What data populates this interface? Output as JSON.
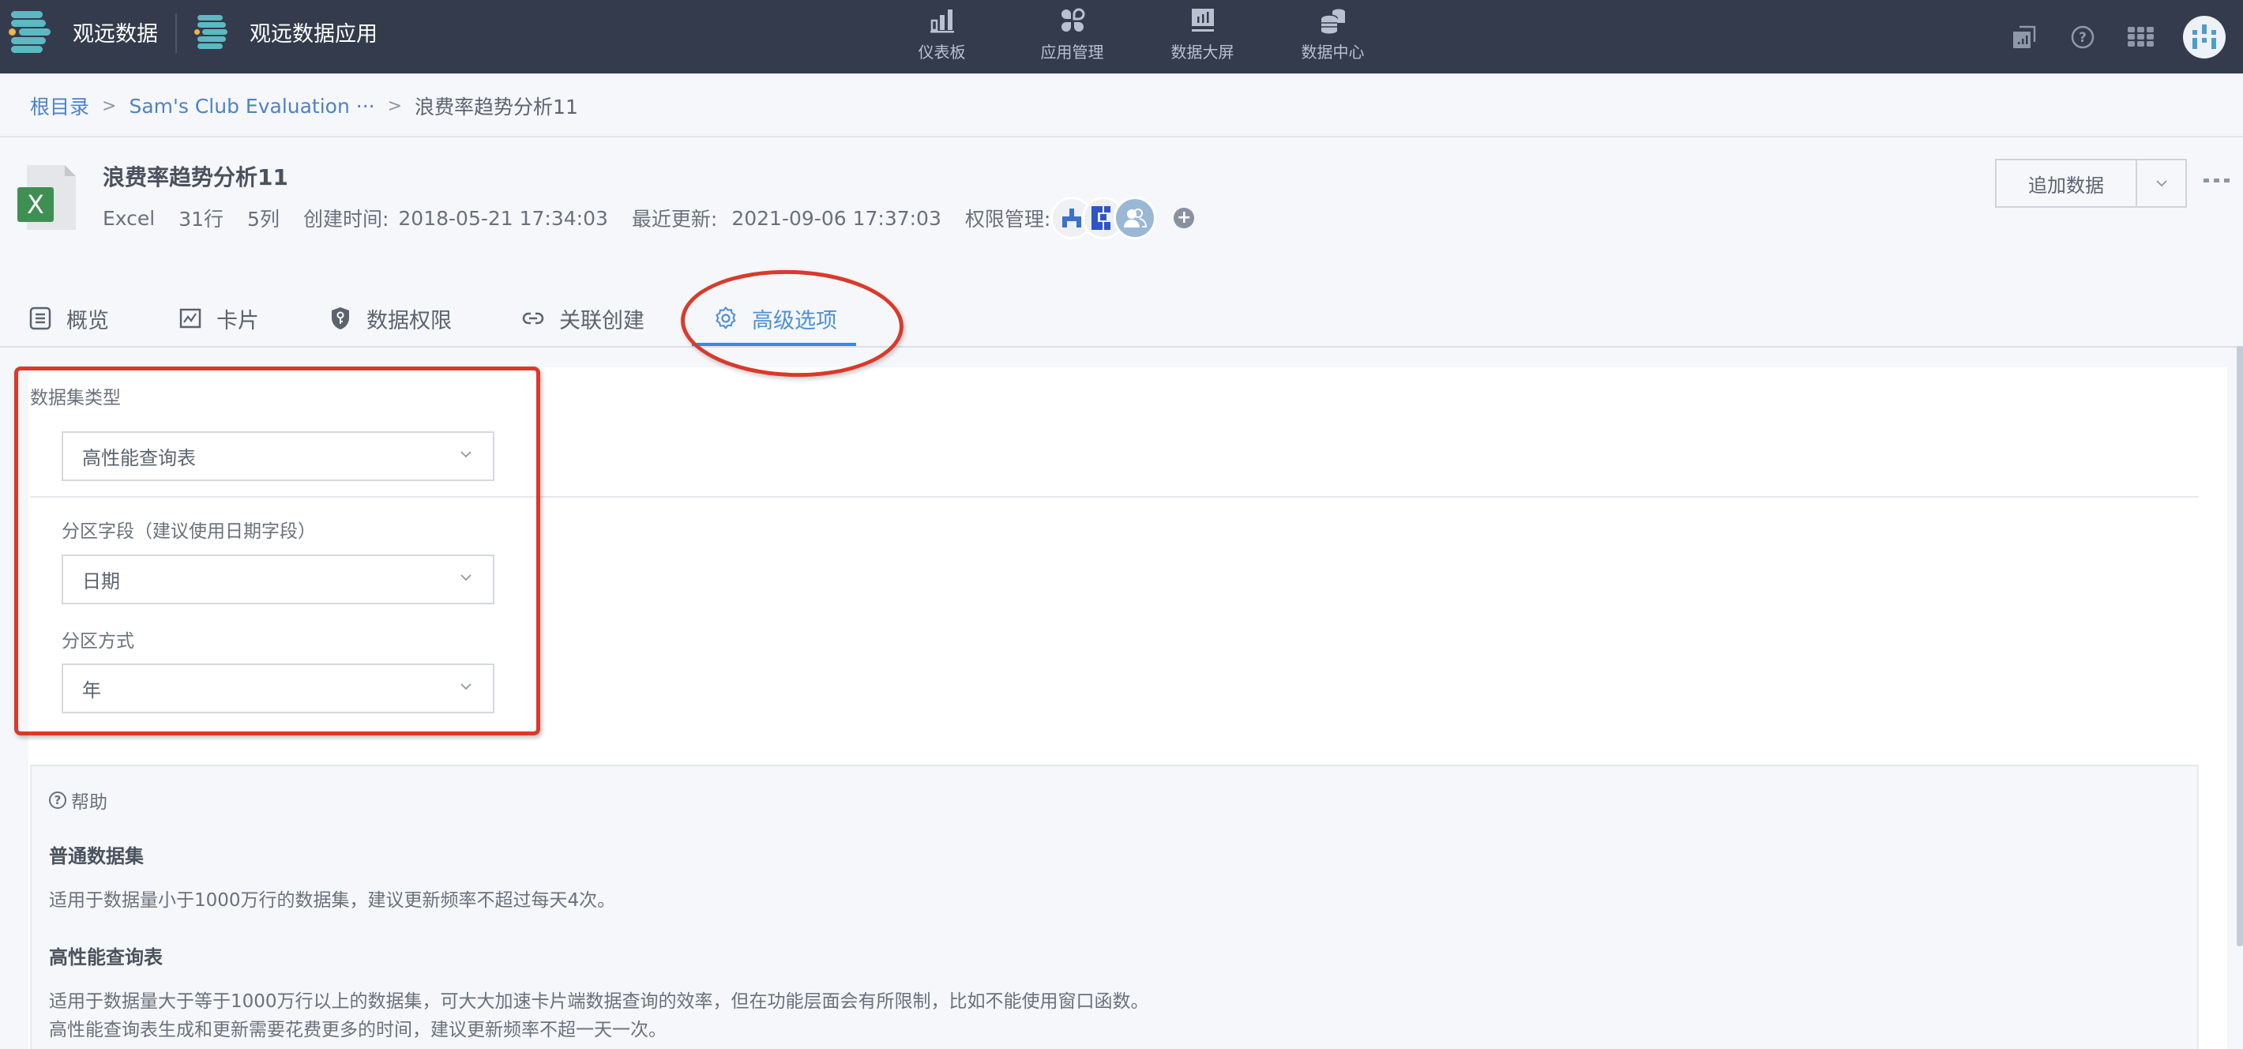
{
  "topnav": {
    "brand_label": "观远数据",
    "app_label": "观远数据应用",
    "items": [
      {
        "label": "仪表板",
        "icon": "bar-chart-icon"
      },
      {
        "label": "应用管理",
        "icon": "app-grid-icon"
      },
      {
        "label": "数据大屏",
        "icon": "big-screen-icon"
      },
      {
        "label": "数据中心",
        "icon": "database-icon"
      }
    ],
    "right_icons": [
      "reports-icon",
      "help-icon",
      "apps-grid-icon",
      "user-avatar"
    ]
  },
  "breadcrumb": {
    "root": "根目录",
    "folder": "Sam's Club Evaluation ···",
    "current": "浪费率趋势分析11",
    "separator": ">"
  },
  "header": {
    "title": "浪费率趋势分析11",
    "file_type": "Excel",
    "rows": "31行",
    "cols": "5列",
    "created_label": "创建时间:",
    "created_value": "2018-05-21 17:34:03",
    "updated_label": "最近更新:",
    "updated_value": "2021-09-06 17:37:03",
    "perm_label": "权限管理:",
    "add_data_label": "追加数据"
  },
  "tabs": [
    {
      "label": "概览",
      "icon": "document-icon",
      "active": false
    },
    {
      "label": "卡片",
      "icon": "chart-card-icon",
      "active": false
    },
    {
      "label": "数据权限",
      "icon": "shield-key-icon",
      "active": false
    },
    {
      "label": "关联创建",
      "icon": "link-icon",
      "active": false
    },
    {
      "label": "高级选项",
      "icon": "gear-icon",
      "active": true
    }
  ],
  "form": {
    "dataset_type_label": "数据集类型",
    "dataset_type_value": "高性能查询表",
    "partition_field_label": "分区字段（建议使用日期字段）",
    "partition_field_value": "日期",
    "partition_mode_label": "分区方式",
    "partition_mode_value": "年"
  },
  "help": {
    "title": "帮助",
    "sections": [
      {
        "heading": "普通数据集",
        "lines": [
          "适用于数据量小于1000万行的数据集，建议更新频率不超过每天4次。"
        ]
      },
      {
        "heading": "高性能查询表",
        "lines": [
          "适用于数据量大于等于1000万行以上的数据集，可大大加速卡片端数据查询的效率，但在功能层面会有所限制，比如不能使用窗口函数。",
          "高性能查询表生成和更新需要花费更多的时间，建议更新频率不超一天一次。"
        ]
      }
    ]
  },
  "colors": {
    "nav_bg": "#343b4d",
    "accent": "#3a87e6",
    "annotation_red": "#d93a2b",
    "logo_teal": "#5bb9c1",
    "logo_dot": "#f0b24a"
  }
}
